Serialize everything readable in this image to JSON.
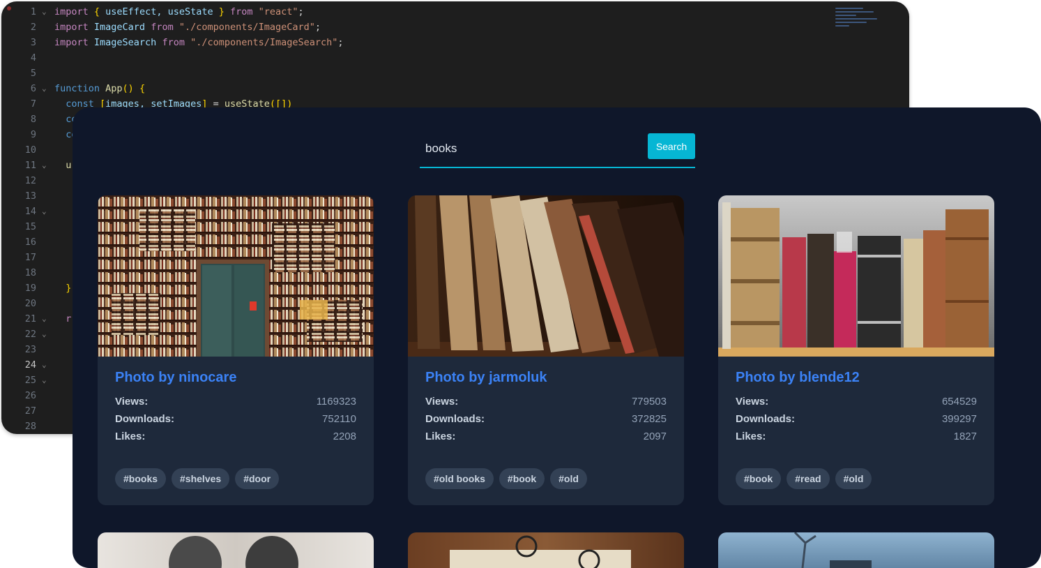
{
  "editor": {
    "lines": [
      {
        "n": "1",
        "fold": true,
        "code": [
          [
            "import ",
            "kw"
          ],
          [
            "{ ",
            "br"
          ],
          [
            "useEffect, useState ",
            "var"
          ],
          [
            "} ",
            "br"
          ],
          [
            "from ",
            "kw"
          ],
          [
            "\"react\"",
            "str"
          ],
          [
            ";",
            "plain"
          ]
        ]
      },
      {
        "n": "2",
        "fold": false,
        "code": [
          [
            "import ",
            "kw"
          ],
          [
            "ImageCard ",
            "var"
          ],
          [
            "from ",
            "kw"
          ],
          [
            "\"./components/ImageCard\"",
            "str"
          ],
          [
            ";",
            "plain"
          ]
        ]
      },
      {
        "n": "3",
        "fold": false,
        "code": [
          [
            "import ",
            "kw"
          ],
          [
            "ImageSearch ",
            "var"
          ],
          [
            "from ",
            "kw"
          ],
          [
            "\"./components/ImageSearch\"",
            "str"
          ],
          [
            ";",
            "plain"
          ]
        ]
      },
      {
        "n": "4",
        "fold": false,
        "code": []
      },
      {
        "n": "5",
        "fold": false,
        "code": []
      },
      {
        "n": "6",
        "fold": true,
        "code": [
          [
            "function ",
            "blue"
          ],
          [
            "App",
            "fn"
          ],
          [
            "() ",
            "br"
          ],
          [
            "{",
            "br"
          ]
        ]
      },
      {
        "n": "7",
        "fold": false,
        "code": [
          [
            "  const ",
            "blue"
          ],
          [
            "[",
            "br"
          ],
          [
            "images, setImages",
            "var"
          ],
          [
            "] ",
            "br"
          ],
          [
            "= ",
            "plain"
          ],
          [
            "useState",
            "fn"
          ],
          [
            "([])",
            "br"
          ]
        ]
      },
      {
        "n": "8",
        "fold": false,
        "code": [
          [
            "  co",
            "blue"
          ]
        ]
      },
      {
        "n": "9",
        "fold": false,
        "code": [
          [
            "  co",
            "blue"
          ]
        ]
      },
      {
        "n": "10",
        "fold": false,
        "code": []
      },
      {
        "n": "11",
        "fold": true,
        "code": [
          [
            "  u",
            "fn"
          ]
        ]
      },
      {
        "n": "12",
        "fold": false,
        "code": []
      },
      {
        "n": "13",
        "fold": false,
        "code": []
      },
      {
        "n": "14",
        "fold": true,
        "code": []
      },
      {
        "n": "15",
        "fold": false,
        "code": []
      },
      {
        "n": "16",
        "fold": false,
        "code": []
      },
      {
        "n": "17",
        "fold": false,
        "code": []
      },
      {
        "n": "18",
        "fold": false,
        "code": []
      },
      {
        "n": "19",
        "fold": false,
        "code": [
          [
            "  }",
            "br"
          ]
        ]
      },
      {
        "n": "20",
        "fold": false,
        "code": []
      },
      {
        "n": "21",
        "fold": true,
        "code": [
          [
            "  r",
            "kw"
          ]
        ]
      },
      {
        "n": "22",
        "fold": true,
        "code": []
      },
      {
        "n": "23",
        "fold": false,
        "code": []
      },
      {
        "n": "24",
        "fold": true,
        "active": true,
        "code": []
      },
      {
        "n": "25",
        "fold": true,
        "code": []
      },
      {
        "n": "26",
        "fold": false,
        "code": []
      },
      {
        "n": "27",
        "fold": false,
        "code": []
      },
      {
        "n": "28",
        "fold": false,
        "code": []
      }
    ]
  },
  "search": {
    "value": "books",
    "button_label": "Search"
  },
  "labels": {
    "views": "Views:",
    "downloads": "Downloads:",
    "likes": "Likes:"
  },
  "cards": [
    {
      "title": "Photo by ninocare",
      "views": "1169323",
      "downloads": "752110",
      "likes": "2208",
      "tags": [
        "#books",
        "#shelves",
        "#door"
      ],
      "image": "bookshelf-door"
    },
    {
      "title": "Photo by jarmoluk",
      "views": "779503",
      "downloads": "372825",
      "likes": "2097",
      "tags": [
        "#old books",
        "#book",
        "#old"
      ],
      "image": "old-books-leaning"
    },
    {
      "title": "Photo by blende12",
      "views": "654529",
      "downloads": "399297",
      "likes": "1827",
      "tags": [
        "#book",
        "#read",
        "#old"
      ],
      "image": "antique-books-row"
    }
  ],
  "colors": {
    "app_bg": "#0f172a",
    "card_bg": "#1e293b",
    "accent": "#06b6d4",
    "title": "#3b82f6",
    "tag_bg": "#334155"
  }
}
